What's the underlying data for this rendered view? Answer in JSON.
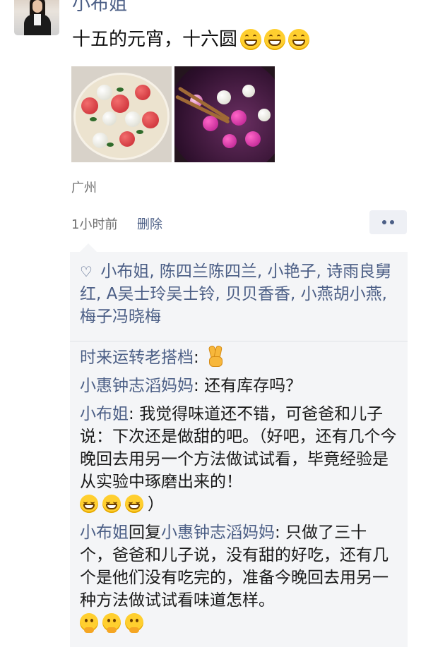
{
  "post": {
    "author": "小布姐",
    "text": "十五的元宵，十六圆",
    "emoji_icons": [
      "grinning-face-icon",
      "grinning-face-icon",
      "grinning-face-icon"
    ],
    "location": "广州",
    "time": "1小时前",
    "delete_label": "删除"
  },
  "likes": {
    "names": "小布姐, 陈四兰陈四兰, 小艳子, 诗雨良舅红, A吴士玲吴士铃, 贝贝香香, 小燕胡小燕, 梅子冯晓梅"
  },
  "comments": [
    {
      "name": "时来运转老搭档",
      "separator": ": ",
      "text": "",
      "emoji": "victory-hand-icon"
    },
    {
      "name": "小惠钟志滔妈妈",
      "separator": ": ",
      "text": "还有库存吗？"
    },
    {
      "name": "小布姐",
      "separator": ": ",
      "text": "我觉得味道还不错，可爸爸和儿子说：下次还是做甜的吧。（好吧，还有几个今晚回去用另一个方法做试试看，毕竟经验是从实验中琢磨出来的！",
      "text_after_emoji": "）",
      "emoji": "squinting-grin-icon"
    },
    {
      "name": "小布姐",
      "reply_word": "回复",
      "reply_to": "小惠钟志滔妈妈",
      "separator": ": ",
      "text": "只做了三十个，爸爸和儿子说，没有甜的好吃，还有几个是他们没有吃完的，准备今晚回去用另一种方法做试试看味道怎样。",
      "emoji": "thinking-face-icon"
    }
  ],
  "colors": {
    "name_link": "#4c5f86",
    "panel_bg": "#f4f5f7",
    "meta_text": "#6f6f6f"
  }
}
